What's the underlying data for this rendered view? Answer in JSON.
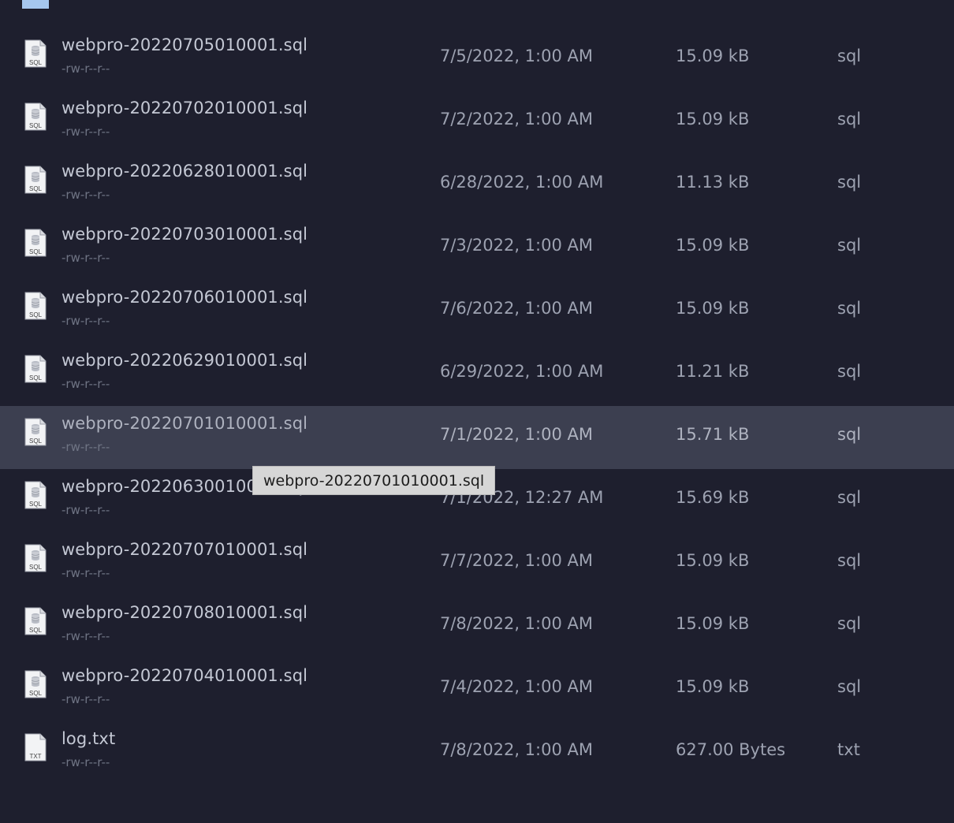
{
  "folder": {
    "label": "..",
    "icon": "folder-icon"
  },
  "files": [
    {
      "name": "webpro-20220705010001.sql",
      "permissions": "-rw-r--r--",
      "modified": "7/5/2022, 1:00 AM",
      "size": "15.09 kB",
      "kind": "sql",
      "icon": "sql-file-icon",
      "selected": false
    },
    {
      "name": "webpro-20220702010001.sql",
      "permissions": "-rw-r--r--",
      "modified": "7/2/2022, 1:00 AM",
      "size": "15.09 kB",
      "kind": "sql",
      "icon": "sql-file-icon",
      "selected": false
    },
    {
      "name": "webpro-20220628010001.sql",
      "permissions": "-rw-r--r--",
      "modified": "6/28/2022, 1:00 AM",
      "size": "11.13 kB",
      "kind": "sql",
      "icon": "sql-file-icon",
      "selected": false
    },
    {
      "name": "webpro-20220703010001.sql",
      "permissions": "-rw-r--r--",
      "modified": "7/3/2022, 1:00 AM",
      "size": "15.09 kB",
      "kind": "sql",
      "icon": "sql-file-icon",
      "selected": false
    },
    {
      "name": "webpro-20220706010001.sql",
      "permissions": "-rw-r--r--",
      "modified": "7/6/2022, 1:00 AM",
      "size": "15.09 kB",
      "kind": "sql",
      "icon": "sql-file-icon",
      "selected": false
    },
    {
      "name": "webpro-20220629010001.sql",
      "permissions": "-rw-r--r--",
      "modified": "6/29/2022, 1:00 AM",
      "size": "11.21 kB",
      "kind": "sql",
      "icon": "sql-file-icon",
      "selected": false
    },
    {
      "name": "webpro-20220701010001.sql",
      "permissions": "-rw-r--r--",
      "modified": "7/1/2022, 1:00 AM",
      "size": "15.71 kB",
      "kind": "sql",
      "icon": "sql-file-icon",
      "selected": true
    },
    {
      "name": "webpro-20220630010001.sql",
      "permissions": "-rw-r--r--",
      "modified": "7/1/2022, 12:27 AM",
      "size": "15.69 kB",
      "kind": "sql",
      "icon": "sql-file-icon",
      "selected": false
    },
    {
      "name": "webpro-20220707010001.sql",
      "permissions": "-rw-r--r--",
      "modified": "7/7/2022, 1:00 AM",
      "size": "15.09 kB",
      "kind": "sql",
      "icon": "sql-file-icon",
      "selected": false
    },
    {
      "name": "webpro-20220708010001.sql",
      "permissions": "-rw-r--r--",
      "modified": "7/8/2022, 1:00 AM",
      "size": "15.09 kB",
      "kind": "sql",
      "icon": "sql-file-icon",
      "selected": false
    },
    {
      "name": "webpro-20220704010001.sql",
      "permissions": "-rw-r--r--",
      "modified": "7/4/2022, 1:00 AM",
      "size": "15.09 kB",
      "kind": "sql",
      "icon": "sql-file-icon",
      "selected": false
    },
    {
      "name": "log.txt",
      "permissions": "-rw-r--r--",
      "modified": "7/8/2022, 1:00 AM",
      "size": "627.00 Bytes",
      "kind": "txt",
      "icon": "txt-file-icon",
      "selected": false
    }
  ],
  "tooltip": {
    "text": "webpro-20220701010001.sql"
  },
  "colors": {
    "background": "#1e1f2e",
    "selected_row": "#3c3f50",
    "folder": "#8fb8e8",
    "tooltip_bg": "#d6d6d6"
  }
}
